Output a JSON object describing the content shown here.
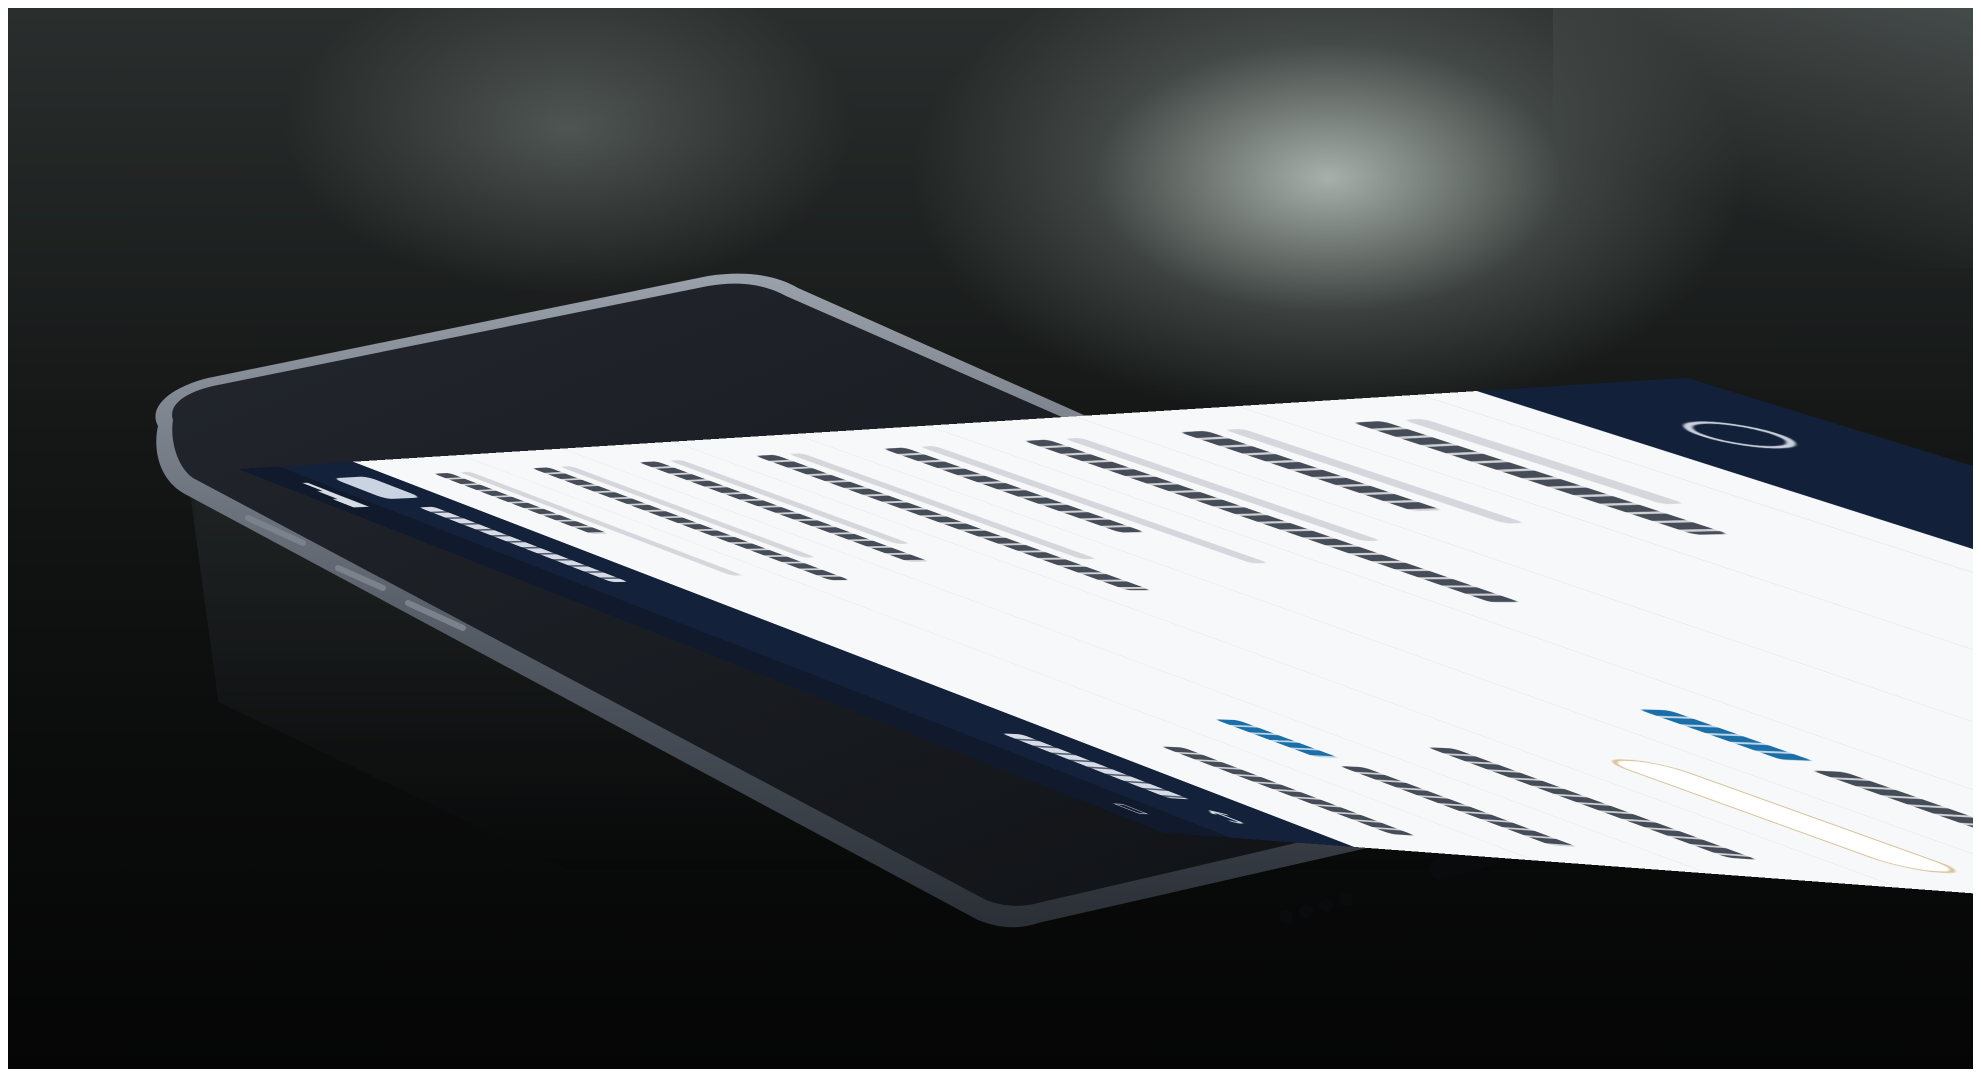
{
  "scene": {
    "description_type": "photo",
    "background_color": "#0b0c0c",
    "highlight_color": "#cdd7d0"
  },
  "phone": {
    "body_color": "#1a1d22",
    "frame_color": "#8a9099",
    "screen_theme": {
      "header_color": "#14213a",
      "content_color": "#f7f8f9",
      "accent_color": "#1b6fa8",
      "pill_border_color": "#d8c29a"
    },
    "icons": [
      "signal-icon",
      "battery-icon",
      "app-logo-icon",
      "back-arrow-icon",
      "compass-icon",
      "chat-icon",
      "cloud-icon",
      "edit-icon",
      "card-icon"
    ]
  }
}
